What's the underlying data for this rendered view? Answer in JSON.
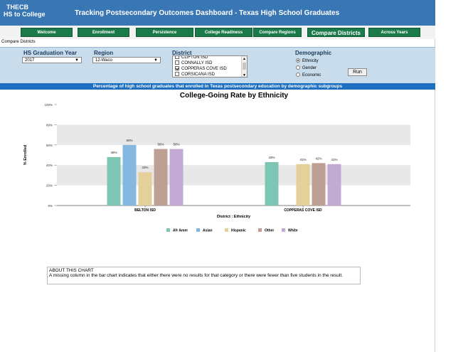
{
  "header": {
    "logo_line1": "THECB",
    "logo_line2": "HS to College",
    "title": "Tracking Postsecondary Outcomes Dashboard - Texas High School Graduates"
  },
  "nav": {
    "welcome": "Welcome",
    "enrollment": "Enrollment",
    "persistence": "Persistence",
    "college_readiness": "College Readiness",
    "compare_regions": "Compare Regions",
    "compare_districts": "Compare Districts",
    "across_years": "Across Years"
  },
  "breadcrumb": "Compare Districts",
  "filters": {
    "year_label": "HS Graduation Year",
    "year_value": "2017",
    "region_label": "Region",
    "region_value": "12-Waco",
    "district_label": "District",
    "districts": [
      {
        "name": "CLIFTON ISD",
        "checked": false
      },
      {
        "name": "CONNALLY ISD",
        "checked": false
      },
      {
        "name": "COPPERAS COVE ISD",
        "checked": true
      },
      {
        "name": "CORSICANA ISD",
        "checked": false
      }
    ],
    "demographic_label": "Demographic",
    "demographics": [
      {
        "label": "Ethnicity",
        "selected": true
      },
      {
        "label": "Gender",
        "selected": false
      },
      {
        "label": "Economic",
        "selected": false
      }
    ],
    "run_label": "Run"
  },
  "banner": "Percentage of high school graduates that enrolled in Texas postsecondary education by demographic subgroups",
  "chart_data": {
    "type": "bar",
    "title": "College-Going Rate by Ethnicity",
    "xlabel": "District : Ethnicity",
    "ylabel": "% Enrolled",
    "ylim": [
      0,
      100
    ],
    "yticks": [
      "0%",
      "20%",
      "40%",
      "60%",
      "80%",
      "100%"
    ],
    "categories": [
      "BELTON ISD",
      "COPPERAS COVE ISD"
    ],
    "series": [
      {
        "name": "Afr Amer",
        "color": "#7ec6b4",
        "values": [
          48,
          43
        ]
      },
      {
        "name": "Asian",
        "color": "#84b8e0",
        "values": [
          60,
          null
        ]
      },
      {
        "name": "Hispanic",
        "color": "#e5cf9a",
        "values": [
          33,
          41
        ]
      },
      {
        "name": "Other",
        "color": "#bda093",
        "values": [
          56,
          42
        ]
      },
      {
        "name": "White",
        "color": "#c2aad4",
        "values": [
          56,
          41
        ]
      }
    ],
    "legend_position": "bottom",
    "grid": "alternating bands"
  },
  "about": {
    "heading": "ABOUT THIS CHART",
    "text": "A missing column in the bar chart indicates that either there were no results for that category or there were fewer than five students in the result."
  }
}
